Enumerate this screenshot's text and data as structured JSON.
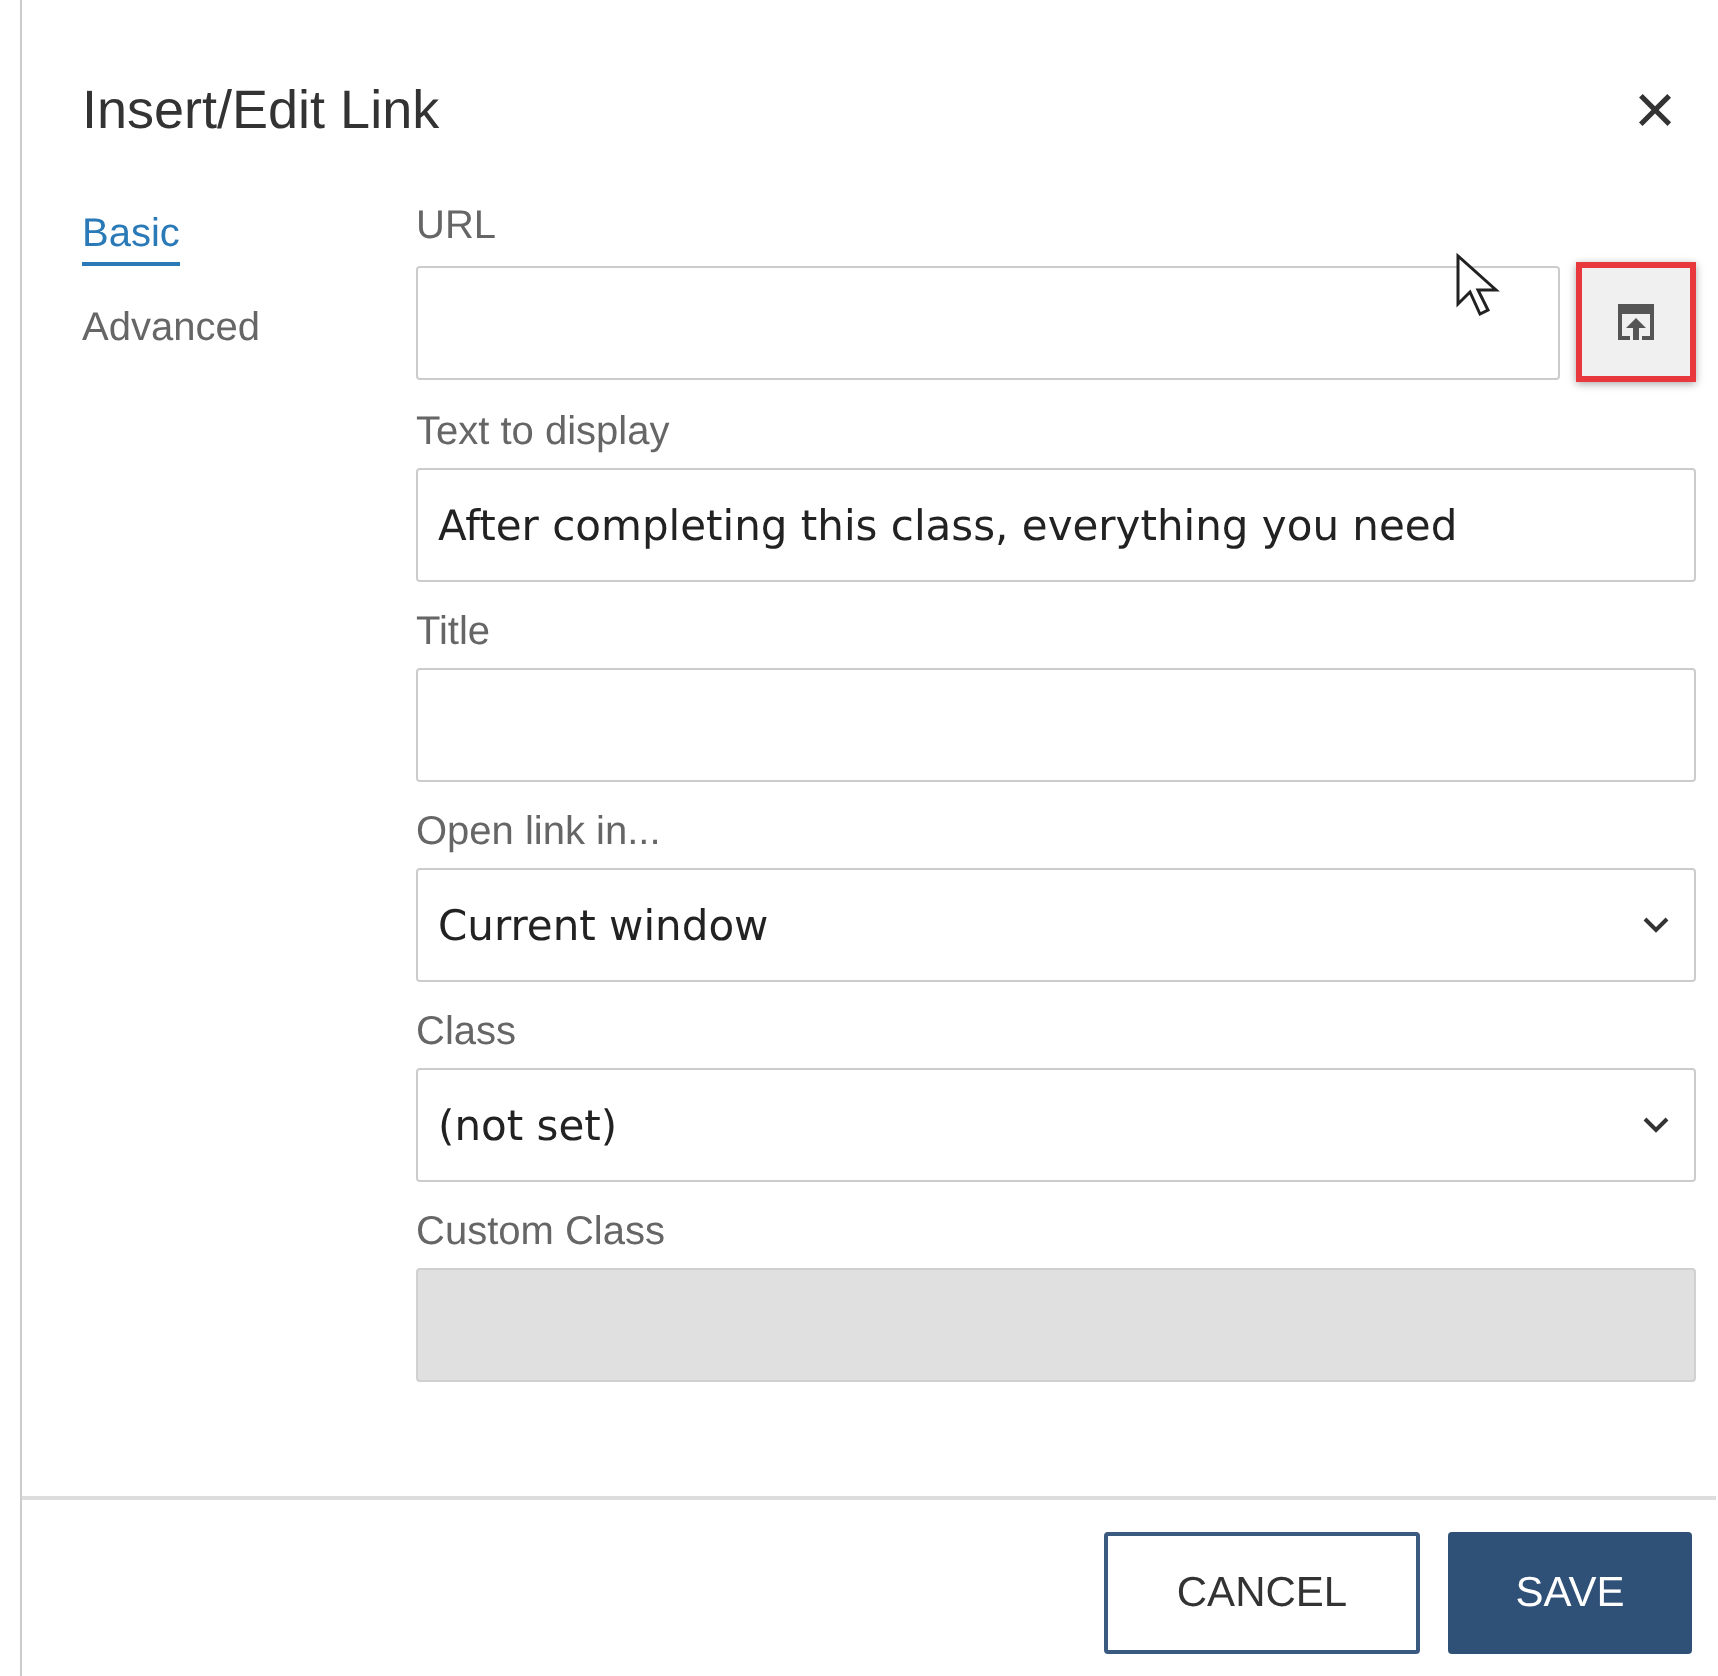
{
  "dialog": {
    "title": "Insert/Edit Link",
    "close": "×"
  },
  "tabs": [
    {
      "label": "Basic",
      "selected": true
    },
    {
      "label": "Advanced",
      "selected": false
    }
  ],
  "fields": [
    {
      "label": "URL",
      "kind": "text",
      "disabled": false,
      "browse_button": {
        "highlighted": true
      }
    },
    {
      "label": "Text to display",
      "kind": "text",
      "value": "After completing this class, everything you need",
      "disabled": false
    },
    {
      "label": "Title",
      "kind": "text",
      "disabled": false
    },
    {
      "label": "Open link in...",
      "kind": "select",
      "value": "Current window",
      "disabled": false
    },
    {
      "label": "Class",
      "kind": "select",
      "value": "(not set)",
      "disabled": false
    },
    {
      "label": "Custom Class",
      "kind": "text",
      "disabled": true
    }
  ],
  "buttons": [
    {
      "label": "CANCEL",
      "kind": "secondary"
    },
    {
      "label": "SAVE",
      "kind": "primary"
    }
  ]
}
